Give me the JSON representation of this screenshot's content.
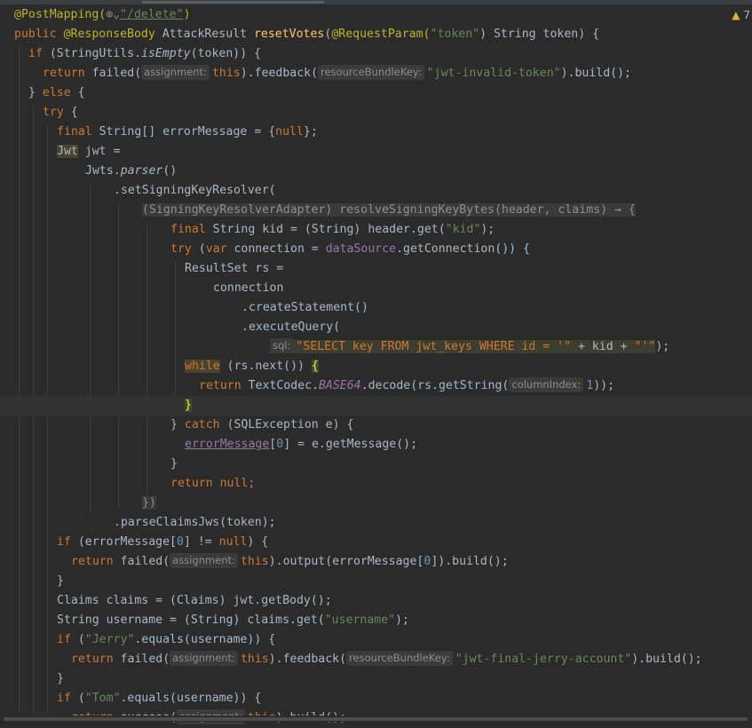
{
  "inspections": {
    "warning_count": "7",
    "warning_icon": "warning-triangle-icon"
  },
  "code": {
    "l1": {
      "a": "@PostMapping(",
      "b": "\"/delete\"",
      "c": ")"
    },
    "l2": {
      "a": "public",
      "b": "@ResponseBody",
      "c": " AttackResult ",
      "d": "resetVotes",
      "e": "(",
      "f": "@RequestParam",
      "g": "(",
      "h": "\"token\"",
      "i": ") String token) {"
    },
    "l3": {
      "a": "if",
      "b": " (StringUtils.",
      "c": "isEmpty",
      "d": "(token)) {"
    },
    "l4": {
      "a": "return",
      "b": " failed(",
      "hint": "assignment:",
      "c": "this",
      "d": ").feedback(",
      "hint2": "resourceBundleKey:",
      "e": "\"jwt-invalid-token\"",
      "f": ").build();"
    },
    "l5": {
      "a": "} ",
      "b": "else",
      "c": " {"
    },
    "l6": {
      "a": "try",
      "b": " {"
    },
    "l7": {
      "a": "final",
      "b": " String[] errorMessage = {",
      "c": "null",
      "d": "};"
    },
    "l8": {
      "a": "Jwt",
      "b": " jwt ="
    },
    "l9": {
      "a": "Jwts.",
      "b": "parser",
      "c": "()"
    },
    "l10": {
      "a": ".setSigningKeyResolver("
    },
    "l11": {
      "a": "(SigningKeyResolverAdapter) resolveSigningKeyBytes(header, claims) → {"
    },
    "l12": {
      "a": "final",
      "b": " String kid = (String) header.get(",
      "c": "\"kid\"",
      "d": ");"
    },
    "l13": {
      "a": "try",
      "b": " (",
      "c": "var",
      "d": " connection = ",
      "e": "dataSource",
      "f": ".getConnection()) {"
    },
    "l14": {
      "a": "ResultSet rs ="
    },
    "l15": {
      "a": "connection"
    },
    "l16": {
      "a": ".createStatement()"
    },
    "l17": {
      "a": ".executeQuery("
    },
    "l18": {
      "hint": "sql:",
      "a": "\"SELECT key FROM jwt_keys ",
      "b": "WHERE",
      "c": " id = '\"",
      "d": " + kid + ",
      "e": "\"'\"",
      "f": ");"
    },
    "l19": {
      "a": "while",
      "b": " (rs.next()) ",
      "c": "{"
    },
    "l20": {
      "a": "return",
      "b": " TextCodec.",
      "c": "BASE64",
      "d": ".decode(rs.getString(",
      "hint": "columnIndex:",
      "e": "1",
      "f": "));"
    },
    "l21": {
      "a": "}"
    },
    "l22": {
      "a": "} ",
      "b": "catch",
      "c": " (SQLException e) {"
    },
    "l23": {
      "a": "errorMessage",
      "b": "[",
      "c": "0",
      "d": "] = e.getMessage();"
    },
    "l24": {
      "a": "}"
    },
    "l25": {
      "a": "return",
      "b": " ",
      "c": "null",
      "d": ";"
    },
    "l26": {
      "a": "})"
    },
    "l27": {
      "a": ".parseClaimsJws(token);"
    },
    "l28": {
      "a": "if",
      "b": " (errorMessage[",
      "c": "0",
      "d": "] != ",
      "e": "null",
      "f": ") {"
    },
    "l29": {
      "a": "return",
      "b": " failed(",
      "hint": "assignment:",
      "c": "this",
      "d": ").output(errorMessage[",
      "e": "0",
      "f": "]).build();"
    },
    "l30": {
      "a": "}"
    },
    "l31": {
      "a": "Claims claims = (Claims) jwt.getBody();"
    },
    "l32": {
      "a": "String username = (String) claims.get(",
      "b": "\"username\"",
      "c": ");"
    },
    "l33": {
      "a": "if",
      "b": " (",
      "c": "\"Jerry\"",
      "d": ".equals(username)) {"
    },
    "l34": {
      "a": "return",
      "b": " failed(",
      "hint": "assignment:",
      "c": "this",
      "d": ").feedback(",
      "hint2": "resourceBundleKey:",
      "e": "\"jwt-final-jerry-account\"",
      "f": ").build();"
    },
    "l35": {
      "a": "}"
    },
    "l36": {
      "a": "if",
      "b": " (",
      "c": "\"Tom\"",
      "d": ".equals(username)) {"
    },
    "l37": {
      "a": "return",
      "b": " success(",
      "hint": "assignment:",
      "c": "this",
      "d": ").build();"
    }
  }
}
